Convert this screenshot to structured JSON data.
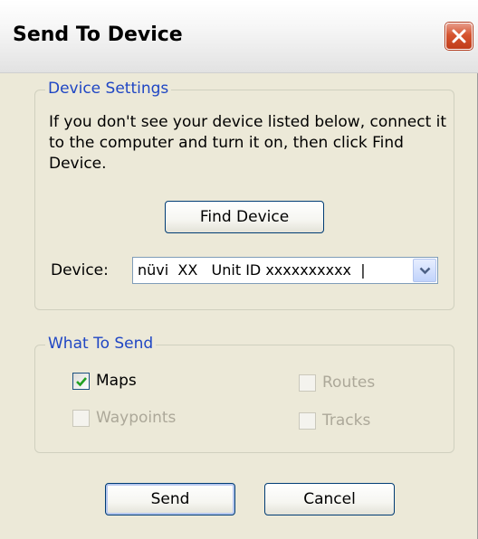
{
  "window": {
    "title": "Send To Device",
    "close_icon": "close-icon"
  },
  "device_settings": {
    "legend": "Device Settings",
    "description": "If you don't see your device listed below, connect it to the computer and turn it on, then click Find Device.",
    "find_device_label": "Find Device",
    "device_label": "Device:",
    "device_value": "nüvi  XX   Unit ID xxxxxxxxxx  |",
    "dropdown_icon": "chevron-down-icon"
  },
  "what_to_send": {
    "legend": "What To Send",
    "items": [
      {
        "label": "Maps",
        "checked": true,
        "enabled": true
      },
      {
        "label": "Routes",
        "checked": false,
        "enabled": false
      },
      {
        "label": "Waypoints",
        "checked": false,
        "enabled": false
      },
      {
        "label": "Tracks",
        "checked": false,
        "enabled": false
      }
    ]
  },
  "buttons": {
    "send_label": "Send",
    "cancel_label": "Cancel"
  },
  "colors": {
    "accent": "#1f46c4",
    "window_bg": "#ece9d8",
    "disabled_text": "#aca899",
    "close_red": "#d6542f"
  }
}
